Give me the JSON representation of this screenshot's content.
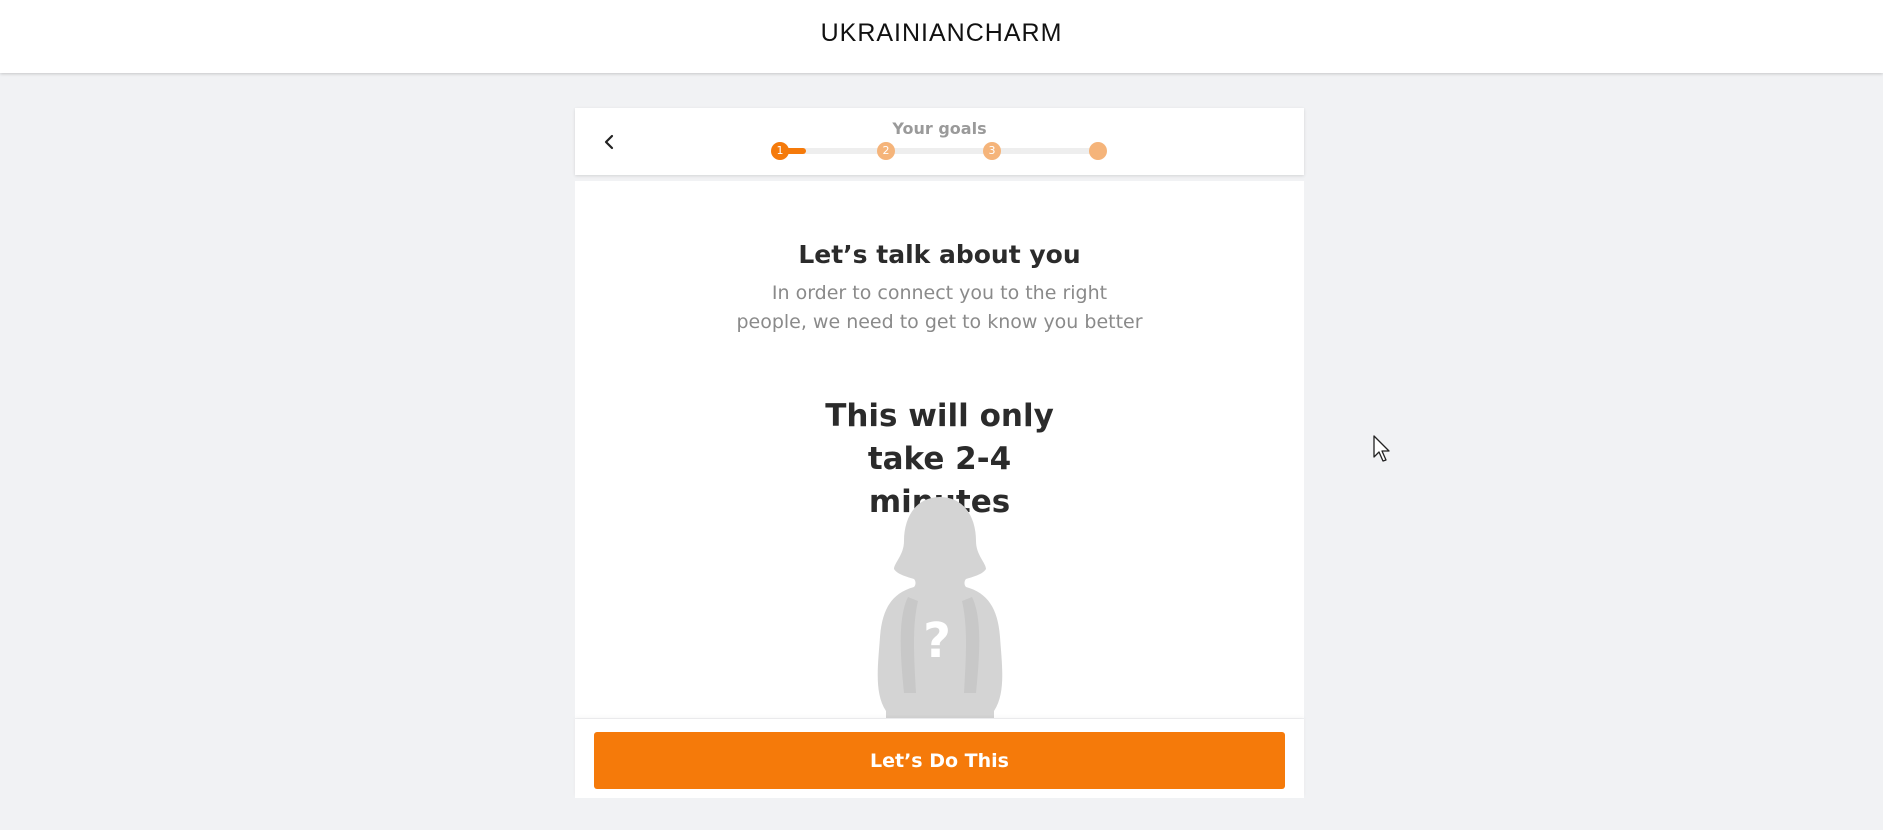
{
  "header": {
    "brand": "UKRAINIANCHARM"
  },
  "steps": {
    "title": "Your goals",
    "progress": 0.08,
    "items": [
      {
        "label": "1",
        "state": "active"
      },
      {
        "label": "2",
        "state": "upcoming"
      },
      {
        "label": "3",
        "state": "upcoming"
      },
      {
        "label": "",
        "state": "upcoming"
      }
    ]
  },
  "intro": {
    "heading": "Let’s talk about you",
    "subtitle": "In order to connect you to the right people, we need to get to know you better",
    "duration": "This will only take 2-4 minutes"
  },
  "silhouette": {
    "mark": "?"
  },
  "footer": {
    "cta_label": "Let’s Do This"
  },
  "colors": {
    "accent": "#f57a0a",
    "accent_light": "#f5b47a",
    "background": "#f1f2f4",
    "silhouette": "#d4d4d4"
  },
  "icons": {
    "back": "chevron-left-icon",
    "cursor": "mouse-pointer-icon"
  }
}
